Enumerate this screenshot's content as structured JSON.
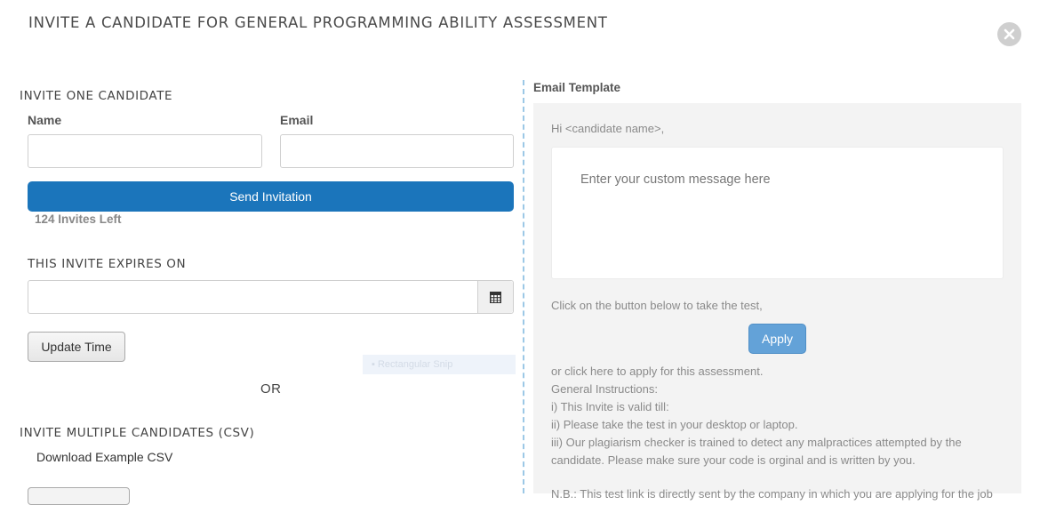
{
  "modal": {
    "title": "INVITE A CANDIDATE FOR GENERAL PROGRAMMING ABILITY ASSESSMENT",
    "close_icon": "close-circle-icon"
  },
  "invite_one": {
    "heading": "INVITE ONE CANDIDATE",
    "name_label": "Name",
    "name_value": "",
    "email_label": "Email",
    "email_value": "",
    "send_label": "Send Invitation",
    "invites_left": "124 Invites Left"
  },
  "expiry": {
    "heading": "THIS INVITE EXPIRES ON",
    "date_value": "",
    "calendar_icon": "calendar-icon",
    "update_label": "Update Time"
  },
  "overlay": {
    "snip_label": "Rectangular Snip"
  },
  "or_label": "OR",
  "invite_multiple": {
    "heading": "INVITE MULTIPLE CANDIDATES (CSV)",
    "download_label": "Download Example CSV"
  },
  "email_template": {
    "heading": "Email Template",
    "greeting": "Hi <candidate name>,",
    "message_placeholder": "Enter your custom message here",
    "click_text": "Click on the button below to take the test,",
    "apply_label": "Apply",
    "lines": [
      "or click here to apply for this assessment.",
      "General Instructions:",
      "i) This Invite is valid till:",
      "ii) Please take the test in your desktop or laptop.",
      "iii) Our plagiarism checker is trained to detect any malpractices attempted by the candidate. Please make sure your code is orginal and is written by you."
    ],
    "cut_line": "N.B.: This test link is directly sent by the company in which you are applying for the job"
  },
  "colors": {
    "primary": "#1b75bb",
    "apply": "#63a2d8",
    "panel": "#f3f3f3",
    "divider": "#9cc8e6"
  }
}
